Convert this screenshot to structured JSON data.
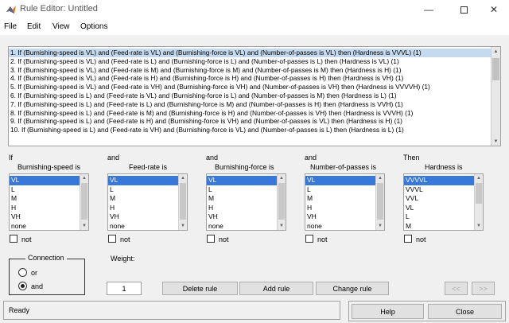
{
  "window": {
    "title": "Rule Editor: Untitled"
  },
  "menu": [
    "File",
    "Edit",
    "View",
    "Options"
  ],
  "rules": [
    "1. If (Burnishing-speed is VL) and (Feed-rate is VL) and (Burnishing-force is VL) and (Number-of-passes is VL) then (Hardness is VVVL) (1)",
    "2. If (Burnishing-speed is VL) and (Feed-rate is L) and (Burnishing-force is L) and (Number-of-passes is L) then (Hardness is VL) (1)",
    "3. If (Burnishing-speed is VL) and (Feed-rate is M) and (Burnishing-force is M) and (Number-of-passes is M) then (Hardness is H) (1)",
    "4. If (Burnishing-speed is VL) and (Feed-rate is H) and (Burnishing-force is H) and (Number-of-passes is H) then (Hardness is VH) (1)",
    "5. If (Burnishing-speed is VL) and (Feed-rate is VH) and (Burnishing-force is VH) and (Number-of-passes is VH) then (Hardness is VVVVH) (1)",
    "6. If (Burnishing-speed is L) and (Feed-rate is VL) and (Burnishing-force is L) and (Number-of-passes is M) then (Hardness is L) (1)",
    "7. If (Burnishing-speed is L) and (Feed-rate is L) and (Burnishing-force is M) and (Number-of-passes is H) then (Hardness is VVH) (1)",
    "8. If (Burnishing-speed is L) and (Feed-rate is M) and (Burnishing-force is H) and (Number-of-passes is VH) then (Hardness is VVVH) (1)",
    "9. If (Burnishing-speed is L) and (Feed-rate is H) and (Burnishing-force is VH) and (Number-of-passes is VL) then (Hardness is H) (1)",
    "10. If (Burnishing-speed is L) and (Feed-rate is VH) and (Burnishing-force is VL) and (Number-of-passes is L) then (Hardness is L) (1)"
  ],
  "inputs": [
    {
      "connector": "If",
      "name": "Burnishing-speed is",
      "options": [
        "VL",
        "L",
        "M",
        "H",
        "VH",
        "none"
      ],
      "not_label": "not"
    },
    {
      "connector": "and",
      "name": "Feed-rate is",
      "options": [
        "VL",
        "L",
        "M",
        "H",
        "VH",
        "none"
      ],
      "not_label": "not"
    },
    {
      "connector": "and",
      "name": "Burnishing-force is",
      "options": [
        "VL",
        "L",
        "M",
        "H",
        "VH",
        "none"
      ],
      "not_label": "not"
    },
    {
      "connector": "and",
      "name": "Number-of-passes is",
      "options": [
        "VL",
        "L",
        "M",
        "H",
        "VH",
        "none"
      ],
      "not_label": "not"
    }
  ],
  "output": {
    "connector": "Then",
    "name": "Hardness is",
    "options": [
      "VVVVL",
      "VVVL",
      "VVL",
      "VL",
      "L",
      "M"
    ],
    "not_label": "not"
  },
  "connection": {
    "title": "Connection",
    "or": "or",
    "and": "and",
    "selected": "and"
  },
  "weight": {
    "label": "Weight:",
    "value": "1"
  },
  "buttons": {
    "delete": "Delete rule",
    "add": "Add rule",
    "change": "Change rule",
    "prev": "<<",
    "next": ">>"
  },
  "status": "Ready",
  "footer": {
    "help": "Help",
    "close": "Close"
  }
}
